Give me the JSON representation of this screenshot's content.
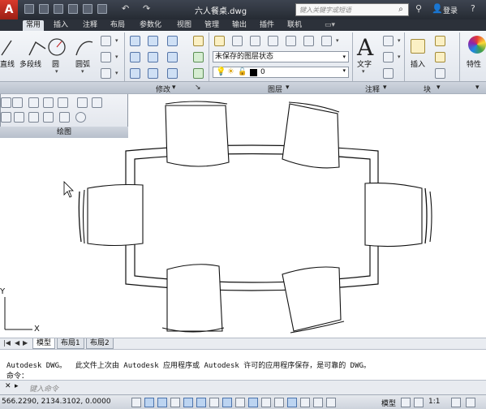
{
  "titlebar": {
    "app_glyph": "A",
    "document_title": "六人餐桌.dwg",
    "search_placeholder": "键入关键字或短语",
    "login_label": "登录",
    "icons": [
      "new-icon",
      "open-icon",
      "save-icon",
      "saveas-icon",
      "print-icon",
      "undo-icon",
      "redo-icon",
      "search-icon",
      "binoculars-icon",
      "user-icon",
      "help-icon"
    ]
  },
  "tabs": [
    {
      "label": "常用",
      "active": true
    },
    {
      "label": "插入",
      "active": false
    },
    {
      "label": "注释",
      "active": false
    },
    {
      "label": "布局",
      "active": false
    },
    {
      "label": "参数化",
      "active": false
    },
    {
      "label": "视图",
      "active": false
    },
    {
      "label": "管理",
      "active": false
    },
    {
      "label": "输出",
      "active": false
    },
    {
      "label": "插件",
      "active": false
    },
    {
      "label": "联机",
      "active": false
    }
  ],
  "ribbon": {
    "draw": {
      "tools": [
        "直线",
        "多段线",
        "圆",
        "圆弧"
      ],
      "panel_title": "绘图"
    },
    "modify": {
      "panel_title": "修改"
    },
    "layers": {
      "layer_state": "未保存的图层状态",
      "current_layer": "0",
      "panel_title": "图层"
    },
    "annotation": {
      "text_label": "文字",
      "panel_title": "注释"
    },
    "block": {
      "insert_label": "插入",
      "panel_title": "块"
    },
    "properties": {
      "label": "特性"
    }
  },
  "layout_tabs": [
    {
      "label": "模型",
      "active": true
    },
    {
      "label": "布局1",
      "active": false
    },
    {
      "label": "布局2",
      "active": false
    }
  ],
  "command": {
    "history": "Autodesk DWG。  此文件上次由 Autodesk 应用程序或 Autodesk 许可的应用程序保存，是可靠的 DWG。",
    "prompt": "命令：",
    "input_placeholder": "键入命令"
  },
  "status": {
    "coords": "566.2290, 2134.3102, 0.0000",
    "model_label": "模型",
    "scale_label": "1:1"
  },
  "colors": {
    "titlebar": "#2b3039",
    "app_button": "#c5301f",
    "ribbon": "#e6eaf0"
  }
}
